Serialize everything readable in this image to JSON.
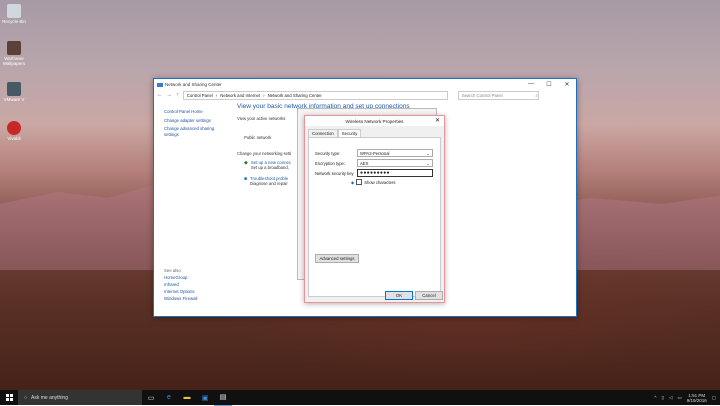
{
  "desktop": {
    "icons": [
      {
        "label": "Recycle Bin",
        "color": "#cfd8dc"
      },
      {
        "label": "Warframe Wallpapers",
        "color": "#5d4037"
      },
      {
        "label": "VMware V",
        "color": "#455a64"
      },
      {
        "label": "Vivaldi",
        "color": "#c62828"
      }
    ]
  },
  "window": {
    "title": "Network and Sharing Center",
    "controls": {
      "minimize": "—",
      "maximize": "☐",
      "close": "✕"
    },
    "breadcrumb": [
      "Control Panel",
      "Network and Internet",
      "Network and Sharing Center"
    ],
    "search_placeholder": "Search Control Panel",
    "left_pane": [
      "Control Panel Home",
      "Change adapter settings",
      "Change advanced sharing settings"
    ],
    "see_also_title": "See also",
    "see_also": [
      "HomeGroup",
      "Infrared",
      "Internet Options",
      "Windows Firewall"
    ],
    "main": {
      "heading": "View your basic network information and set up connections",
      "active_networks": "View your active networks",
      "network_type": "Public network",
      "change_settings": "Change your networking setti",
      "setup_link": "Set up a new connec",
      "setup_desc": "Set up a broadband,",
      "troubleshoot_link": "Troubleshoot proble",
      "troubleshoot_desc": "Diagnose and repair"
    }
  },
  "dialog": {
    "title": "Wireless Network Properties",
    "close": "✕",
    "tabs": [
      "Connection",
      "Security"
    ],
    "security_type_label": "Security type:",
    "security_type_value": "WPA2-Personal",
    "encryption_label": "Encryption type:",
    "encryption_value": "AES",
    "key_label": "Network security key",
    "key_value": "●●●●●●●●●",
    "show_chars": "Show characters",
    "advanced": "Advanced settings",
    "ok": "OK",
    "cancel": "Cancel"
  },
  "taskbar": {
    "search_text": "Ask me anything",
    "time": "1:51 PM",
    "date": "9/19/2016"
  }
}
